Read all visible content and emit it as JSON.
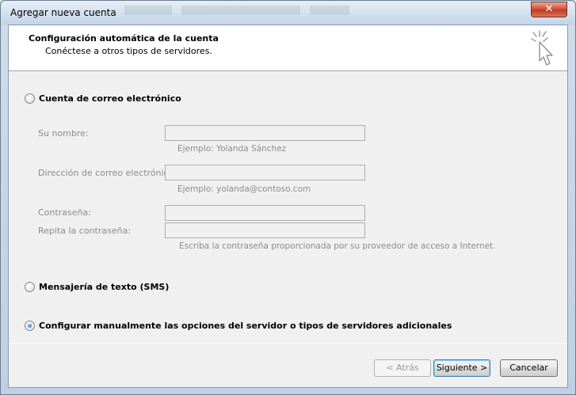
{
  "window": {
    "title": "Agregar nueva cuenta",
    "close_glyph": "✕"
  },
  "header": {
    "title": "Configuración automática de la cuenta",
    "subtitle": "Conéctese a otros tipos de servidores.",
    "icon": "wizard-cursor-icon"
  },
  "options": {
    "email": {
      "label": "Cuenta de correo electrónico",
      "checked": false
    },
    "sms": {
      "label": "Mensajería de texto (SMS)",
      "checked": false
    },
    "manual": {
      "label": "Configurar manualmente las opciones del servidor o tipos de servidores adicionales",
      "checked": true
    }
  },
  "form": {
    "name_label": "Su nombre:",
    "name_value": "",
    "name_hint": "Ejemplo: Yolanda Sánchez",
    "email_label": "Dirección de correo electrónico:",
    "email_value": "",
    "email_hint": "Ejemplo: yolanda@contoso.com",
    "password_label": "Contraseña:",
    "password_value": "",
    "repeat_label": "Repita la contraseña:",
    "repeat_value": "",
    "password_hint": "Escriba la contraseña proporcionada por su proveedor de acceso a Internet."
  },
  "buttons": {
    "back": "< Atrás",
    "next": "Siguiente >",
    "cancel": "Cancelar"
  }
}
